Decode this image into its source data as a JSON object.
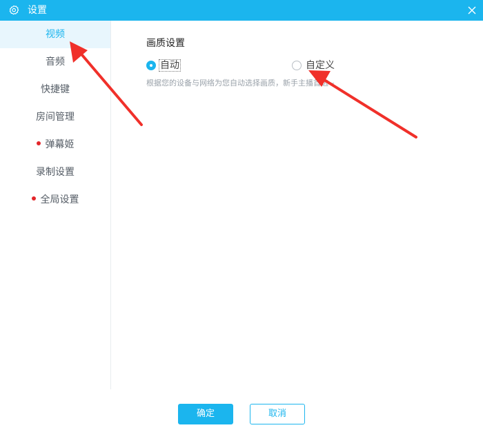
{
  "window": {
    "title": "设置"
  },
  "sidebar": {
    "items": [
      {
        "label": "视频",
        "active": true,
        "dot": false
      },
      {
        "label": "音频",
        "active": false,
        "dot": false
      },
      {
        "label": "快捷键",
        "active": false,
        "dot": false
      },
      {
        "label": "房间管理",
        "active": false,
        "dot": false
      },
      {
        "label": "弹幕姬",
        "active": false,
        "dot": true
      },
      {
        "label": "录制设置",
        "active": false,
        "dot": false
      },
      {
        "label": "全局设置",
        "active": false,
        "dot": true
      }
    ]
  },
  "main": {
    "section_title": "画质设置",
    "options": [
      {
        "label": "自动",
        "checked": true
      },
      {
        "label": "自定义",
        "checked": false
      }
    ],
    "hint": "根据您的设备与网络为您自动选择画质，新手主播首选~"
  },
  "footer": {
    "confirm_label": "确定",
    "cancel_label": "取消"
  },
  "colors": {
    "accent": "#1bb5ee",
    "active_bg": "#e8f6fd",
    "badge_dot": "#e3262a",
    "annotation_arrow": "#f0302a"
  },
  "icons": {
    "title": "gear-icon",
    "close": "close-icon"
  }
}
